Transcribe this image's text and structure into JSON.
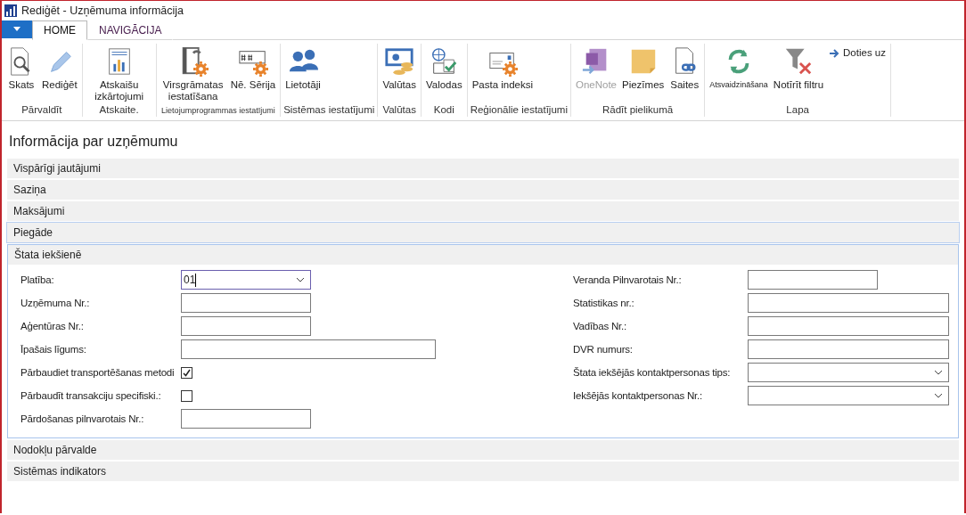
{
  "window": {
    "title": "Rediģēt - Uzņēmuma informācija"
  },
  "tabs": [
    {
      "label": "HOME",
      "selected": true
    },
    {
      "label": "NAVIGĀCIJA",
      "selected": false
    }
  ],
  "ribbon": {
    "groups": [
      {
        "label": "Pārvaldīt",
        "buttons": [
          {
            "label": "Skats",
            "kind": "large",
            "disabled": false
          },
          {
            "label": "Rediģēt",
            "kind": "large",
            "disabled": false
          }
        ]
      },
      {
        "label": "Atskaite.",
        "buttons": [
          {
            "label": "Atskaišu izkārtojumi",
            "kind": "large",
            "disabled": false
          }
        ]
      },
      {
        "label": "Lietojumprogrammas iestatījumi",
        "small_label": true,
        "buttons": [
          {
            "label": "Virsgrāmatas iestatīšana",
            "kind": "large",
            "disabled": false
          },
          {
            "label": "Nē. Sērija",
            "kind": "large",
            "disabled": false
          }
        ]
      },
      {
        "label": "Sistēmas iestatījumi",
        "buttons": [
          {
            "label": "Lietotāji",
            "kind": "large",
            "disabled": false
          }
        ]
      },
      {
        "label": "Valūtas",
        "buttons": [
          {
            "label": "Valūtas",
            "kind": "large",
            "disabled": false
          }
        ]
      },
      {
        "label": "Kodi",
        "buttons": [
          {
            "label": "Valodas",
            "kind": "large",
            "disabled": false
          }
        ]
      },
      {
        "label": "Reģionālie iestatījumi",
        "buttons": [
          {
            "label": "Pasta indeksi",
            "kind": "large",
            "disabled": false
          }
        ]
      },
      {
        "label": "Rādīt pielikumā",
        "buttons": [
          {
            "label": "OneNote",
            "kind": "large",
            "disabled": true
          },
          {
            "label": "Piezīmes",
            "kind": "large",
            "disabled": false
          },
          {
            "label": "Saites",
            "kind": "large",
            "disabled": false
          }
        ]
      },
      {
        "label": "Lapa",
        "buttons": [
          {
            "label": "Atsvaidzināšana",
            "kind": "tiny",
            "disabled": false
          },
          {
            "label": "Notīrīt filtru",
            "kind": "large",
            "disabled": false
          },
          {
            "label": "Doties uz",
            "kind": "small",
            "disabled": false
          }
        ]
      }
    ]
  },
  "page_title": "Informācija par uzņēmumu",
  "sections": [
    {
      "title": "Vispārīgi jautājumi",
      "expanded": false
    },
    {
      "title": "Saziņa",
      "expanded": false
    },
    {
      "title": "Maksājumi",
      "expanded": false
    },
    {
      "title": "Piegāde",
      "expanded": false,
      "hovered": true
    },
    {
      "title": "Štata iekšienē",
      "expanded": true,
      "left_fields": [
        {
          "label": "Platība:",
          "kind": "dropdown",
          "value": "01",
          "focused": true
        },
        {
          "label": "Uzņēmuma Nr.:",
          "kind": "text"
        },
        {
          "label": "Aģentūras Nr.:",
          "kind": "text"
        },
        {
          "label": "Īpašais līgums:",
          "kind": "long_text"
        },
        {
          "label": "Pārbaudiet transportēšanas metodi",
          "kind": "checkbox",
          "checked": true
        },
        {
          "label": "Pārbaudīt transakciju specifiski.:",
          "kind": "checkbox",
          "checked": false
        },
        {
          "label": "Pārdošanas pilnvarotais Nr.:",
          "kind": "text"
        }
      ],
      "right_fields": [
        {
          "label": "Veranda Pilnvarotais Nr.:",
          "kind": "text"
        },
        {
          "label": "Statistikas nr.:",
          "kind": "long_text"
        },
        {
          "label": "Vadības Nr.:",
          "kind": "long_text"
        },
        {
          "label": "DVR numurs:",
          "kind": "long_text"
        },
        {
          "label": "Štata iekšējās kontaktpersonas tips:",
          "kind": "dropdown"
        },
        {
          "label": "Iekšējās kontaktpersonas Nr.:",
          "kind": "dropdown"
        }
      ]
    },
    {
      "title": "Nodokļu pārvalde",
      "expanded": false
    },
    {
      "title": "Sistēmas indikators",
      "expanded": false
    }
  ]
}
